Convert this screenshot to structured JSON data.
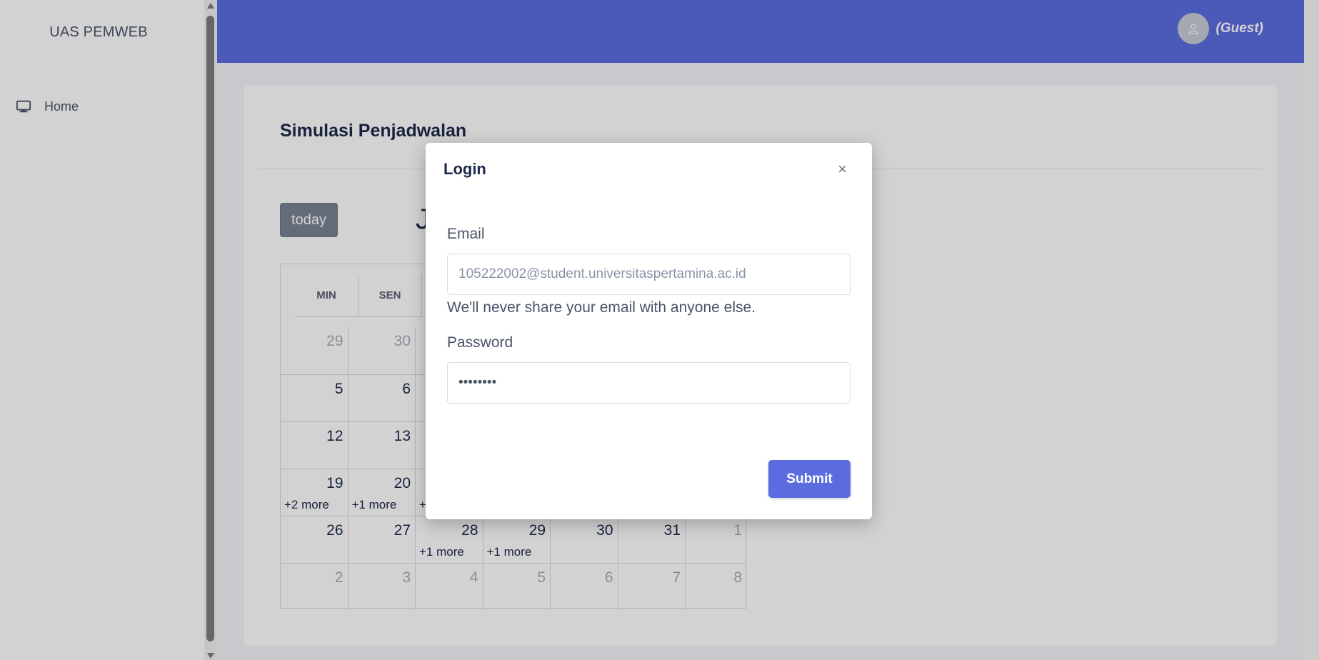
{
  "sidebar": {
    "brand": "UAS PEMWEB",
    "items": [
      {
        "label": "Home",
        "icon": "monitor-icon"
      }
    ]
  },
  "topbar": {
    "user_label": "(Guest)",
    "colors": {
      "primary": "#5b6ce1"
    }
  },
  "card": {
    "title": "Simulasi Penjadwalan",
    "today_label": "today",
    "month_title_partial": "Ja"
  },
  "calendar": {
    "headers": [
      "MIN",
      "SEN"
    ],
    "rows": [
      [
        {
          "d": "29",
          "muted": true
        },
        {
          "d": "30",
          "muted": true
        },
        {
          "d": ""
        },
        {
          "d": ""
        },
        {
          "d": ""
        },
        {
          "d": ""
        },
        {
          "d": ""
        }
      ],
      [
        {
          "d": "5"
        },
        {
          "d": "6"
        },
        {
          "d": ""
        },
        {
          "d": ""
        },
        {
          "d": ""
        },
        {
          "d": ""
        },
        {
          "d": ""
        }
      ],
      [
        {
          "d": "12"
        },
        {
          "d": "13"
        },
        {
          "d": ""
        },
        {
          "d": ""
        },
        {
          "d": ""
        },
        {
          "d": ""
        },
        {
          "d": ""
        }
      ],
      [
        {
          "d": "19",
          "more": "+2 more"
        },
        {
          "d": "20",
          "more": "+1 more"
        },
        {
          "d": "",
          "more": "+"
        },
        {
          "d": ""
        },
        {
          "d": ""
        },
        {
          "d": ""
        },
        {
          "d": ""
        }
      ],
      [
        {
          "d": "26"
        },
        {
          "d": "27"
        },
        {
          "d": "28",
          "more": "+1 more"
        },
        {
          "d": "29",
          "more": "+1 more"
        },
        {
          "d": "30"
        },
        {
          "d": "31"
        },
        {
          "d": "1",
          "muted": true
        }
      ],
      [
        {
          "d": "2",
          "muted": true
        },
        {
          "d": "3",
          "muted": true
        },
        {
          "d": "4",
          "muted": true
        },
        {
          "d": "5",
          "muted": true
        },
        {
          "d": "6",
          "muted": true
        },
        {
          "d": "7",
          "muted": true
        },
        {
          "d": "8",
          "muted": true
        }
      ]
    ]
  },
  "modal": {
    "title": "Login",
    "close": "×",
    "email_label": "Email",
    "email_value": "105222002@student.universitaspertamina.ac.id",
    "email_help": "We'll never share your email with anyone else.",
    "password_label": "Password",
    "password_value": "••••••••",
    "submit_label": "Submit"
  }
}
